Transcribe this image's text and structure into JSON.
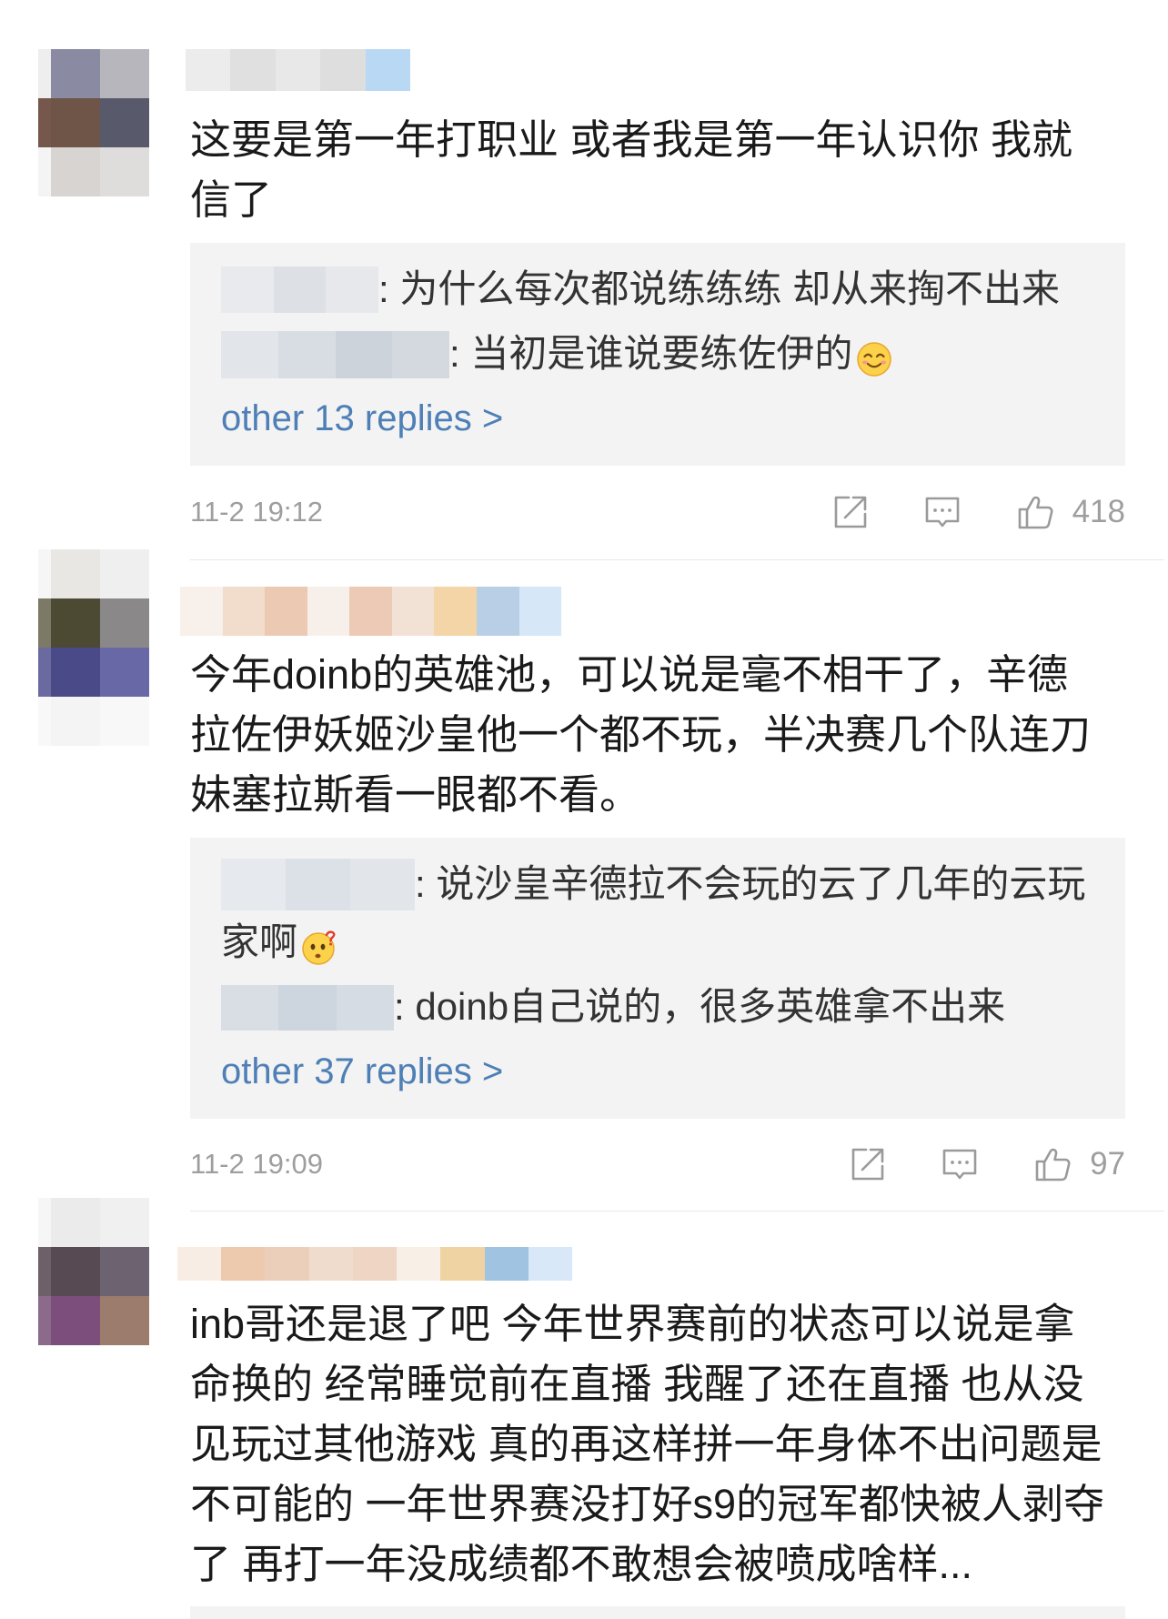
{
  "theme": {
    "text": "#1a1a1a",
    "reply_text": "#333333",
    "link": "#4e7fb6",
    "meta": "#9e9e9e",
    "icon": "#9a9a9a",
    "reply_box": "#f3f3f3",
    "divider": "#e8e8e8"
  },
  "icons": {
    "share": "share-icon",
    "comment": "comment-icon",
    "like": "like-icon"
  },
  "comments": [
    {
      "avatar_tiles": [
        [
          "#eeeeee",
          "#8a8aa2",
          "#b8b6bd"
        ],
        [
          "#75584b",
          "#6f5448",
          "#585a6b"
        ],
        [
          "#f4f4f4",
          "#d8d4d1",
          "#dedddc"
        ]
      ],
      "name_mosaic": [
        "#ececec",
        "#e0e0e0",
        "#e8e8e8",
        "#dedede",
        "#b9d8f4"
      ],
      "body_lines": [
        "这要是第一年打职业 或者我是第一年认识你 我就",
        "信了"
      ],
      "replies": [
        {
          "name_mosaic": [
            "#e8eaed",
            "#dde0e5",
            "#e6e8ec"
          ],
          "lines": [
            ": 为什么每次都说练练练 却从来掏不出来"
          ]
        },
        {
          "name_mosaic": [
            "#e2e5ea",
            "#d8dde3",
            "#cdd3db",
            "#d4d9e0"
          ],
          "lines": [
            ": 当初是谁说要练佐伊的"
          ],
          "emoji": "smile-emoji"
        }
      ],
      "more_replies": "other 13 replies >",
      "time": "11-2 19:12",
      "likes": "418"
    },
    {
      "avatar_tiles": [
        [
          "#f6f6f6",
          "#e8e7e3",
          "#efefef"
        ],
        [
          "#7c7a66",
          "#4d4a33",
          "#8a8888"
        ],
        [
          "#6a6aa0",
          "#4a4a88",
          "#6868a6"
        ],
        [
          "#f8f8f8",
          "#f4f4f4",
          "#f8f8f8"
        ]
      ],
      "name_mosaic": [
        "#f8f0ea",
        "#f2dccc",
        "#ebc9b3",
        "#f7f0ea",
        "#edcab5",
        "#f2e1d5",
        "#f3d5a8",
        "#b8cfe6",
        "#d6e7f8"
      ],
      "body_lines": [
        "今年doinb的英雄池，可以说是毫不相干了，辛德",
        "拉佐伊妖姬沙皇他一个都不玩，半决赛几个队连刀",
        "妹塞拉斯看一眼都不看。"
      ],
      "replies": [
        {
          "name_mosaic": [
            "#e6e9ee",
            "#dce1e7",
            "#e2e6eb"
          ],
          "lines": [
            ": 说沙皇辛德拉不会玩的云了几年的云玩",
            "家啊"
          ],
          "emoji": "thinking-emoji"
        },
        {
          "name_mosaic": [
            "#d9dee5",
            "#cdd5de",
            "#d6dce3"
          ],
          "lines": [
            ": doinb自己说的，很多英雄拿不出来"
          ]
        }
      ],
      "more_replies": "other 37 replies >",
      "time": "11-2 19:09",
      "likes": "97"
    },
    {
      "avatar_tiles": [
        [
          "#f6f6f6",
          "#ebebeb",
          "#f0f0f0"
        ],
        [
          "#6e6068",
          "#584a52",
          "#6d6270"
        ],
        [
          "#8c6a8c",
          "#7c4e7c",
          "#9c7c6c"
        ]
      ],
      "name_mosaic": [
        "#f7ede5",
        "#edc9ae",
        "#ebcfba",
        "#f0dccc",
        "#efd6c4",
        "#f8efe6",
        "#efd3a2",
        "#9fc3e1",
        "#d8e8f8"
      ],
      "body_lines": [
        "inb哥还是退了吧 今年世界赛前的状态可以说是拿",
        "命换的 经常睡觉前在直播 我醒了还在直播 也从没",
        "见玩过其他游戏 真的再这样拼一年身体不出问题是",
        "不可能的 一年世界赛没打好s9的冠军都快被人剥夺",
        "了 再打一年没成绩都不敢想会被喷成啥样..."
      ]
    }
  ]
}
